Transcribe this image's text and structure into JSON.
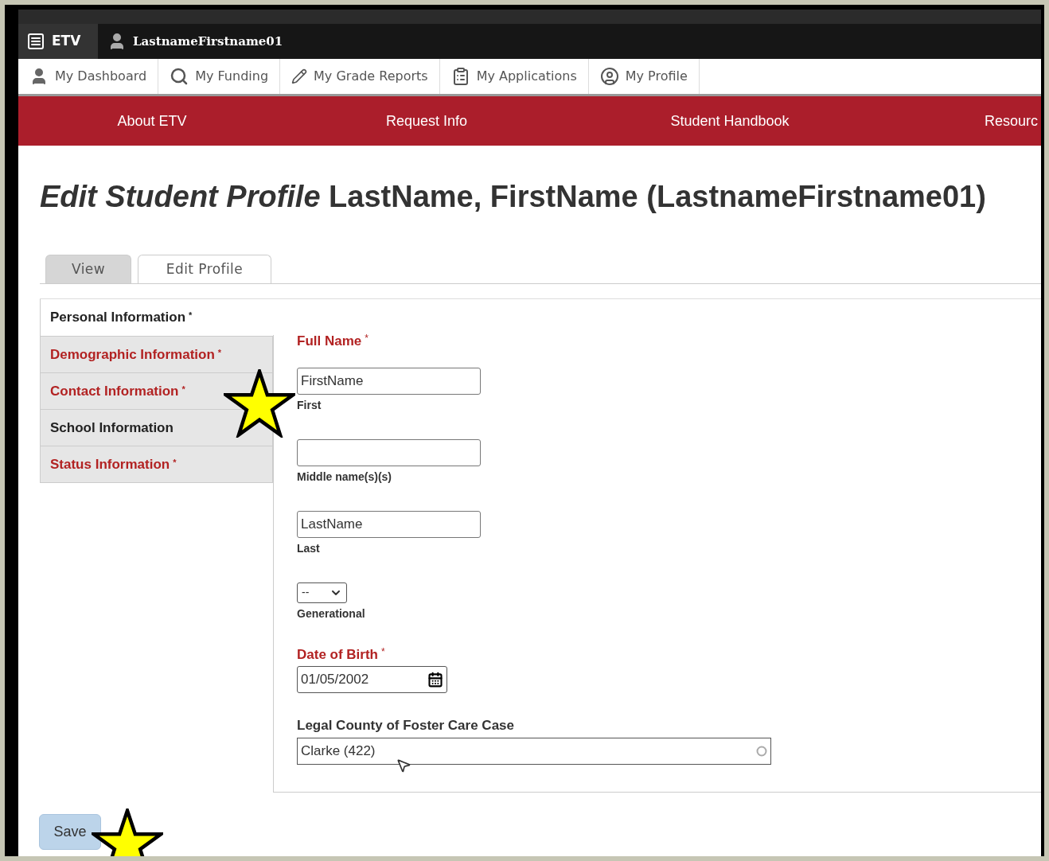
{
  "topbar": {
    "app": "ETV",
    "user": "LastnameFirstname01"
  },
  "nav": [
    {
      "label": "My Dashboard",
      "kind": "user"
    },
    {
      "label": "My Funding",
      "kind": "funding"
    },
    {
      "label": "My Grade Reports",
      "kind": "pencil"
    },
    {
      "label": "My Applications",
      "kind": "clipboard"
    },
    {
      "label": "My Profile",
      "kind": "profile"
    }
  ],
  "menu": [
    "About ETV",
    "Request Info",
    "Student Handbook",
    "Resourc"
  ],
  "title": "*Edit Student Profile* LastName, FirstName (LastnameFirstname01)",
  "tabs": [
    {
      "label": "View",
      "selected": false
    },
    {
      "label": "Edit Profile",
      "selected": true
    }
  ],
  "sidebar": [
    {
      "label": "Personal Information",
      "required": true,
      "selected": true,
      "incomplete": false
    },
    {
      "label": "Demographic Information",
      "required": true,
      "selected": false,
      "incomplete": true
    },
    {
      "label": "Contact Information",
      "required": true,
      "selected": false,
      "incomplete": true
    },
    {
      "label": "School Information",
      "required": false,
      "selected": false,
      "incomplete": false
    },
    {
      "label": "Status Information",
      "required": true,
      "selected": false,
      "incomplete": true
    }
  ],
  "required_mark": "*",
  "full_name": {
    "label": "Full Name",
    "required": true
  },
  "name_parts": [
    {
      "kind": "text",
      "value": "FirstName",
      "caption": "First"
    },
    {
      "kind": "text",
      "caption": "Middle name(s)(s)"
    },
    {
      "kind": "text",
      "value": "LastName",
      "caption": "Last"
    },
    {
      "kind": "select",
      "value": "--",
      "caption": "Generational"
    }
  ],
  "date_of_birth": {
    "label": "Date of Birth",
    "required": true,
    "value": "01/05/2002"
  },
  "county": {
    "label": "Legal County of Foster Care Case",
    "required": false,
    "value": "Clarke (422)"
  },
  "save": "Save"
}
